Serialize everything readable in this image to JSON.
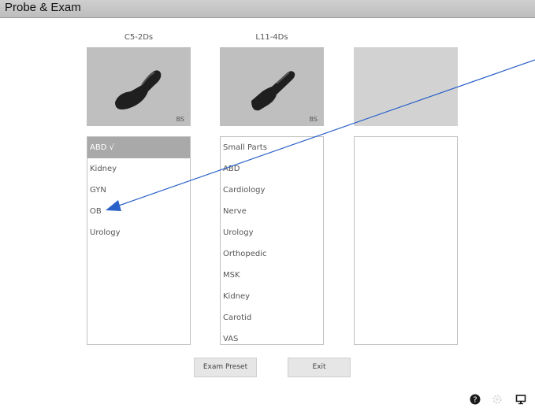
{
  "window": {
    "title": "Probe & Exam"
  },
  "probes": [
    {
      "name": "C5-2Ds",
      "badge": "BS",
      "exams": [
        {
          "label": "ABD √",
          "selected": true
        },
        {
          "label": "Kidney"
        },
        {
          "label": "GYN"
        },
        {
          "label": "OB"
        },
        {
          "label": "Urology"
        }
      ]
    },
    {
      "name": "L11-4Ds",
      "badge": "BS",
      "exams": [
        {
          "label": "Small Parts"
        },
        {
          "label": "ABD"
        },
        {
          "label": "Cardiology"
        },
        {
          "label": "Nerve"
        },
        {
          "label": "Urology"
        },
        {
          "label": "Orthopedic"
        },
        {
          "label": "MSK"
        },
        {
          "label": "Kidney"
        },
        {
          "label": "Carotid"
        },
        {
          "label": "VAS"
        }
      ]
    },
    {
      "name": "",
      "badge": "",
      "exams": []
    }
  ],
  "buttons": {
    "exam_preset": "Exam Preset",
    "exit": "Exit"
  },
  "colors": {
    "annotation_arrow": "#2a62c9",
    "selected_row": "#a9a9a9",
    "probe_bg": "#bfbfbf"
  },
  "status_icons": [
    "help-icon",
    "settings-icon",
    "monitor-icon"
  ]
}
